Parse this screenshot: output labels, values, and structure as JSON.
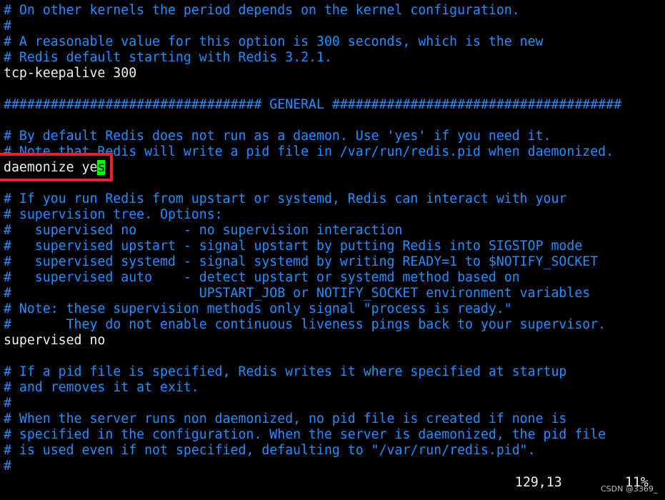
{
  "editor": {
    "lines": [
      {
        "text": "# On other kernels the period depends on the kernel configuration.",
        "type": "comment"
      },
      {
        "text": "#",
        "type": "comment"
      },
      {
        "text": "# A reasonable value for this option is 300 seconds, which is the new",
        "type": "comment"
      },
      {
        "text": "# Redis default starting with Redis 3.2.1.",
        "type": "comment"
      },
      {
        "text": "tcp-keepalive 300",
        "type": "text"
      },
      {
        "text": "",
        "type": "text"
      },
      {
        "text": "################################# GENERAL #####################################",
        "type": "comment"
      },
      {
        "text": "",
        "type": "text"
      },
      {
        "text": "# By default Redis does not run as a daemon. Use 'yes' if you need it.",
        "type": "comment"
      },
      {
        "text": "# Note that Redis will write a pid file in /var/run/redis.pid when daemonized.",
        "type": "comment"
      },
      {
        "text": "daemonize ye",
        "type": "cursorline",
        "cursor_char": "s"
      },
      {
        "text": "",
        "type": "text"
      },
      {
        "text": "# If you run Redis from upstart or systemd, Redis can interact with your",
        "type": "comment"
      },
      {
        "text": "# supervision tree. Options:",
        "type": "comment"
      },
      {
        "text": "#   supervised no      - no supervision interaction",
        "type": "comment"
      },
      {
        "text": "#   supervised upstart - signal upstart by putting Redis into SIGSTOP mode",
        "type": "comment"
      },
      {
        "text": "#   supervised systemd - signal systemd by writing READY=1 to $NOTIFY_SOCKET",
        "type": "comment"
      },
      {
        "text": "#   supervised auto    - detect upstart or systemd method based on",
        "type": "comment"
      },
      {
        "text": "#                        UPSTART_JOB or NOTIFY_SOCKET environment variables",
        "type": "comment"
      },
      {
        "text": "# Note: these supervision methods only signal \"process is ready.\"",
        "type": "comment"
      },
      {
        "text": "#       They do not enable continuous liveness pings back to your supervisor.",
        "type": "comment"
      },
      {
        "text": "supervised no",
        "type": "text"
      },
      {
        "text": "",
        "type": "text"
      },
      {
        "text": "# If a pid file is specified, Redis writes it where specified at startup",
        "type": "comment"
      },
      {
        "text": "# and removes it at exit.",
        "type": "comment"
      },
      {
        "text": "#",
        "type": "comment"
      },
      {
        "text": "# When the server runs non daemonized, no pid file is created if none is",
        "type": "comment"
      },
      {
        "text": "# specified in the configuration. When the server is daemonized, the pid file",
        "type": "comment"
      },
      {
        "text": "# is used even if not specified, defaulting to \"/var/run/redis.pid\".",
        "type": "comment"
      },
      {
        "text": "#",
        "type": "comment"
      }
    ]
  },
  "status": {
    "position": "129,13",
    "percent": "11%"
  },
  "watermark": "CSDN @3369_",
  "colors": {
    "comment": "#1e8fff",
    "text": "#f0f0f0",
    "cursor": "#00ff00",
    "highlight_box": "#e8202a"
  }
}
